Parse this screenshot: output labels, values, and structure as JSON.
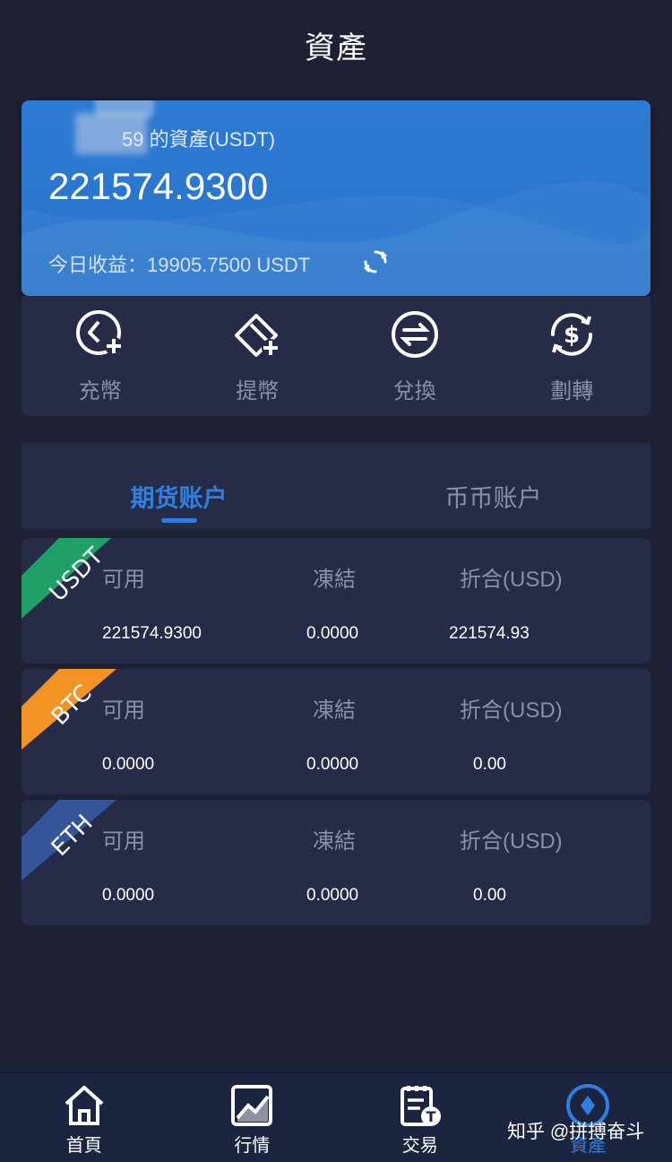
{
  "header": {
    "title": "資產"
  },
  "asset_card": {
    "account_label": "59  的資產(USDT)",
    "total": "221574.9300",
    "income": "今日收益：19905.7500 USDT"
  },
  "actions": [
    {
      "label": "充幣",
      "icon": "deposit-icon"
    },
    {
      "label": "提幣",
      "icon": "withdraw-icon"
    },
    {
      "label": "兌換",
      "icon": "exchange-icon"
    },
    {
      "label": "劃轉",
      "icon": "transfer-icon"
    }
  ],
  "tabs": [
    {
      "label": "期货账户",
      "active": true
    },
    {
      "label": "币币账户",
      "active": false
    }
  ],
  "columns": {
    "available": "可用",
    "frozen": "凍結",
    "converted": "折合(USD)"
  },
  "coins": [
    {
      "name": "USDT",
      "color": "#1fa067",
      "available": "221574.9300",
      "frozen": "0.0000",
      "converted": "221574.93"
    },
    {
      "name": "BTC",
      "color": "#f29324",
      "available": "0.0000",
      "frozen": "0.0000",
      "converted": "0.00"
    },
    {
      "name": "ETH",
      "color": "#34559a",
      "available": "0.0000",
      "frozen": "0.0000",
      "converted": "0.00"
    }
  ],
  "bottom_nav": [
    {
      "label": "首頁",
      "icon": "home-icon"
    },
    {
      "label": "行情",
      "icon": "market-chart-icon"
    },
    {
      "label": "交易",
      "icon": "trade-icon"
    },
    {
      "label": "資產",
      "icon": "asset-diamond-icon",
      "active": true
    }
  ],
  "watermark": "知乎 @拼搏奋斗",
  "colors": {
    "accent": "#2f7fe0",
    "background": "#1e2034",
    "card": "#262b47"
  }
}
